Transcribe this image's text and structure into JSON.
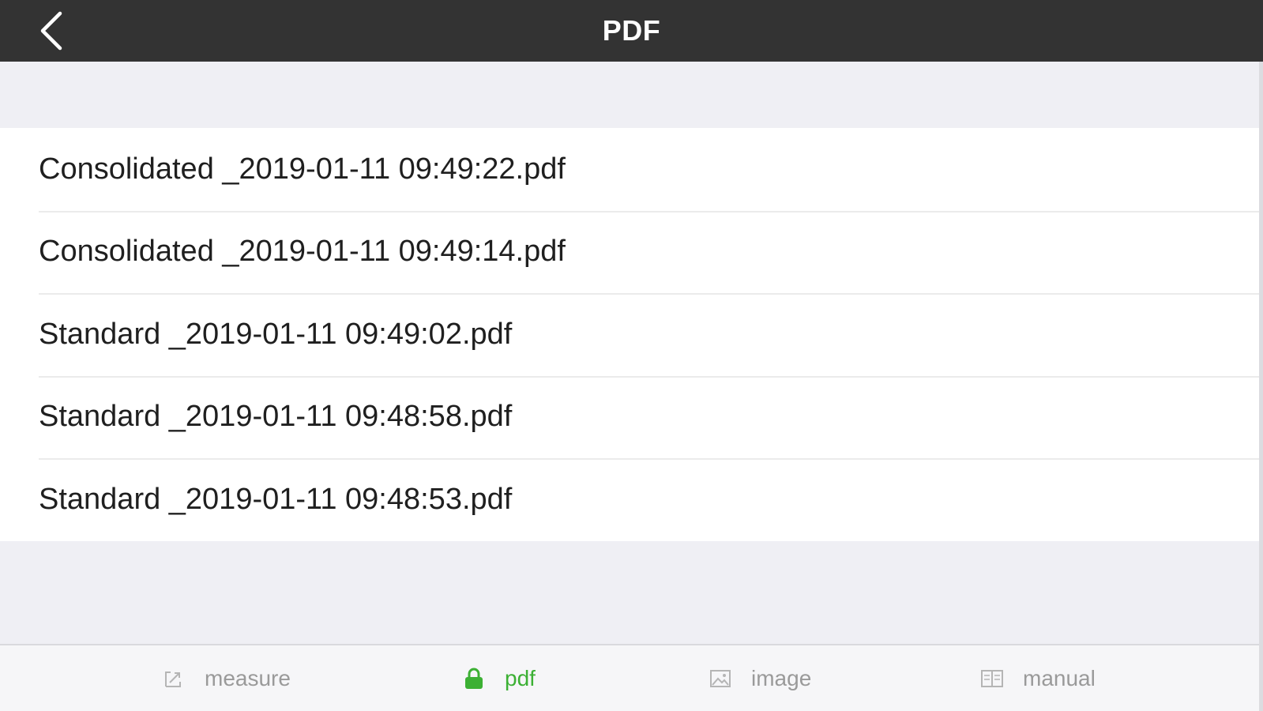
{
  "header": {
    "title": "PDF",
    "back_icon": "chevron-left-icon"
  },
  "files": [
    {
      "name": "Consolidated _2019-01-11 09:49:22.pdf"
    },
    {
      "name": "Consolidated _2019-01-11 09:49:14.pdf"
    },
    {
      "name": "Standard _2019-01-11 09:49:02.pdf"
    },
    {
      "name": "Standard _2019-01-11 09:48:58.pdf"
    },
    {
      "name": "Standard _2019-01-11 09:48:53.pdf"
    }
  ],
  "tabbar": {
    "tabs": [
      {
        "label": "measure",
        "icon": "ruler-icon",
        "active": false
      },
      {
        "label": "pdf",
        "icon": "lock-icon",
        "active": true
      },
      {
        "label": "image",
        "icon": "picture-icon",
        "active": false
      },
      {
        "label": "manual",
        "icon": "book-icon",
        "active": false
      }
    ]
  },
  "colors": {
    "header_bg": "#333333",
    "page_bg": "#efeff4",
    "active_tab": "#3cb034",
    "inactive_tab": "#9a9a9a"
  }
}
